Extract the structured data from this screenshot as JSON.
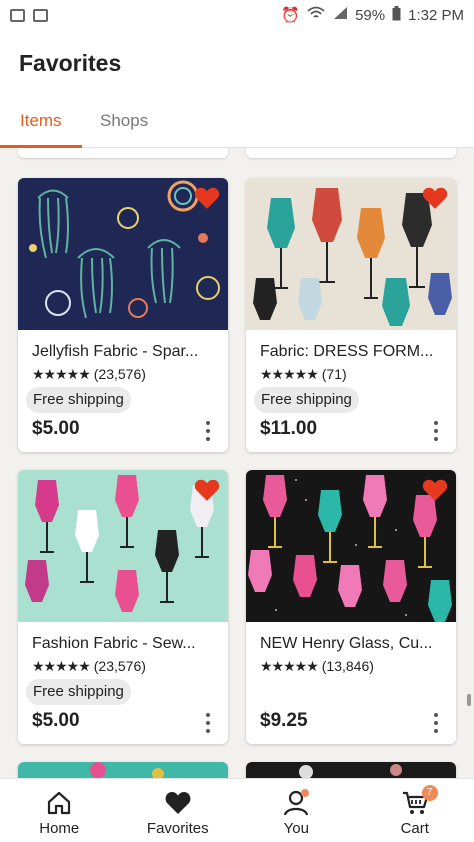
{
  "status_bar": {
    "battery": "59%",
    "time": "1:32 PM"
  },
  "header": {
    "title": "Favorites"
  },
  "tabs": [
    {
      "label": "Items",
      "active": true
    },
    {
      "label": "Shops",
      "active": false
    }
  ],
  "colors": {
    "accent": "#e35d1e",
    "heart": "#e5381e",
    "badge": "#f08a5a"
  },
  "items": [
    {
      "name": "Jellyfish Fabric - Spar...",
      "stars": "★★★★★",
      "reviews": "(23,576)",
      "shipping": "Free shipping",
      "price": "$5.00"
    },
    {
      "name": "Fabric:  DRESS FORM...",
      "stars": "★★★★★",
      "reviews": "(71)",
      "shipping": "Free shipping",
      "price": "$11.00"
    },
    {
      "name": "Fashion Fabric - Sew...",
      "stars": "★★★★★",
      "reviews": "(23,576)",
      "shipping": "Free shipping",
      "price": "$5.00"
    },
    {
      "name": "NEW Henry Glass, Cu...",
      "stars": "★★★★★",
      "reviews": "(13,846)",
      "shipping": "",
      "price": "$9.25"
    }
  ],
  "bottom_nav": [
    {
      "label": "Home",
      "icon": "home-icon"
    },
    {
      "label": "Favorites",
      "icon": "heart-icon"
    },
    {
      "label": "You",
      "icon": "person-icon"
    },
    {
      "label": "Cart",
      "icon": "cart-icon",
      "badge": "7"
    }
  ]
}
